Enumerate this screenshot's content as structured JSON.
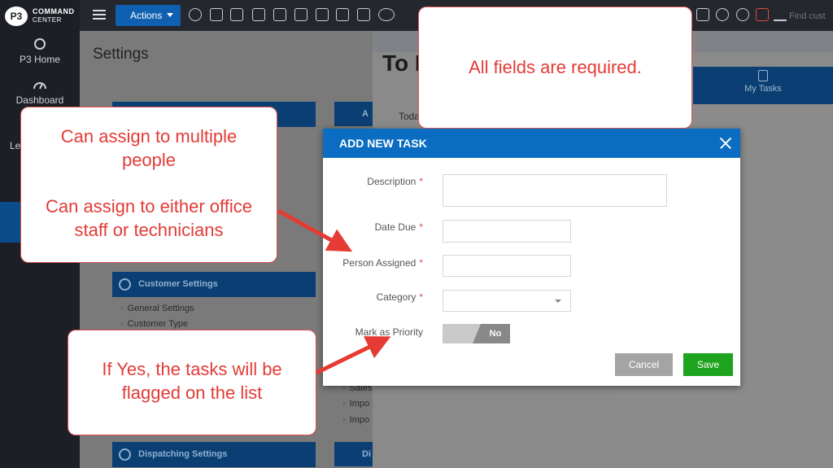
{
  "app": {
    "logo_badge": "P3",
    "logo_line1": "COMMAND",
    "logo_line2": "CENTER"
  },
  "sidebar": {
    "items": [
      {
        "label": "P3 Home"
      },
      {
        "label": "Dashboard"
      },
      {
        "label": "Le"
      }
    ]
  },
  "topbar": {
    "actions_label": "Actions",
    "find_placeholder": "Find cust"
  },
  "settings": {
    "title": "Settings",
    "customer_section": "Customer Settings",
    "customer_links": [
      "General Settings",
      "Customer Type"
    ],
    "dispatching_section": "Dispatching Settings",
    "col2_top": "A",
    "col2_links": [
      "Sales",
      "Impo",
      "Impo"
    ],
    "col2_bottom": "Di"
  },
  "todo": {
    "title_partial": "To I",
    "today_partial": "Toda",
    "my_tasks": "My Tasks"
  },
  "modal": {
    "title": "ADD NEW TASK",
    "required_mark": "*",
    "fields": {
      "description": "Description",
      "date_due": "Date Due",
      "person_assigned": "Person Assigned",
      "category": "Category",
      "priority": "Mark as Priority"
    },
    "priority_value": "No",
    "cancel": "Cancel",
    "save": "Save"
  },
  "callouts": {
    "required": "All fields are required.",
    "assign_1": "Can assign to multiple people",
    "assign_2": "Can assign to either office staff or technicians",
    "priority": "If Yes, the tasks will be flagged on the list"
  }
}
